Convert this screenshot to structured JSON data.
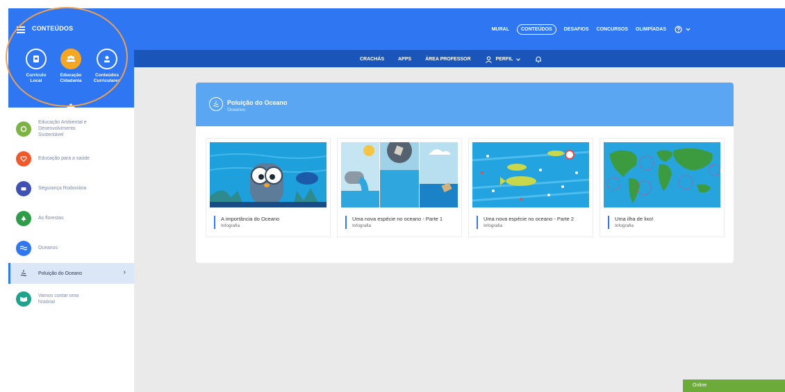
{
  "sidebar": {
    "title": "CONTEÚDOS",
    "categories": [
      {
        "label_1": "Currículo",
        "label_2": "Local",
        "icon": "book-icon"
      },
      {
        "label_1": "Educação",
        "label_2": "Cidadania",
        "icon": "people-icon"
      },
      {
        "label_1": "Conteúdos",
        "label_2": "Curriculares",
        "icon": "student-icon"
      }
    ],
    "items": [
      {
        "label": "Educação Ambiental e Desenvolvimento Sustentável",
        "color": "#7cb342",
        "icon": "recycle-icon"
      },
      {
        "label": "Educação para a saúde",
        "color": "#f1592a",
        "icon": "heart-icon"
      },
      {
        "label": "Segurança Rodoviária",
        "color": "#3f51b5",
        "icon": "car-icon"
      },
      {
        "label": "As florestas",
        "color": "#2e9d4a",
        "icon": "tree-icon"
      },
      {
        "label": "Oceanos",
        "color": "#2f76f2",
        "icon": "wave-icon"
      },
      {
        "label": "Poluição do Oceano",
        "color": "#2f76f2",
        "icon": "water-pollution-icon"
      },
      {
        "label": "Vamos contar uma história!",
        "color": "#1fa38a",
        "icon": "open-book-icon"
      }
    ]
  },
  "nav": {
    "items": [
      "MURAL",
      "CONTEÚDOS",
      "DESAFIOS",
      "CONCURSOS",
      "OLIMPÍADAS"
    ],
    "active": "CONTEÚDOS"
  },
  "subnav": {
    "items": [
      "CRACHÁS",
      "APPS",
      "ÁREA PROFESSOR"
    ],
    "profile": "PERFIL"
  },
  "card": {
    "title": "Poluição do Oceano",
    "subtitle": "Oceanos",
    "items": [
      {
        "title": "A importância do Oceano",
        "type": "Infografia"
      },
      {
        "title": "Uma nova espécie no oceano - Parte 1",
        "type": "Infografia"
      },
      {
        "title": "Uma nova espécie no oceano - Parte 2",
        "type": "Infografia"
      },
      {
        "title": "Uma ilha de lixo!",
        "type": "Infografia"
      }
    ]
  },
  "status": {
    "online": "Online"
  }
}
